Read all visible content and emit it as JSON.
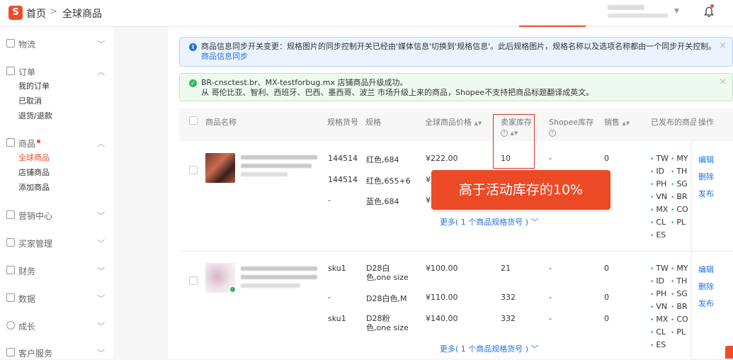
{
  "header": {
    "logo": "S",
    "breadcrumb_home": "首页",
    "breadcrumb_sep": ">",
    "breadcrumb_current": "全球商品"
  },
  "sidebar": {
    "groups": [
      {
        "label": "物流",
        "caret": "﹀"
      },
      {
        "label": "订单",
        "caret": "︿",
        "items": [
          "我的订单",
          "已取消",
          "退货/退款"
        ]
      },
      {
        "label": "商品",
        "caret": "︿",
        "items": [
          "全球商品",
          "店铺商品",
          "添加商品"
        ]
      },
      {
        "label": "营销中心",
        "caret": "﹀"
      },
      {
        "label": "买家管理",
        "caret": "﹀"
      },
      {
        "label": "财务",
        "caret": "﹀"
      },
      {
        "label": "数据",
        "caret": "﹀"
      },
      {
        "label": "成长",
        "caret": "﹀"
      },
      {
        "label": "客户服务",
        "caret": "﹀"
      }
    ]
  },
  "banners": {
    "info_text": "商品信息同步开关变更：规格图片的同步控制开关已经由'媒体信息'切换到'规格信息'。此后规格图片，规格名称以及选项名称都由一个同步开关控制。",
    "info_link": "商品信息同步",
    "ok_line1": "BR-cnsctest.br、MX-testforbug.mx 店铺商品升级成功。",
    "ok_line2": "从 哥伦比亚、智利、西班牙、巴西、墨西哥、波兰 市场升级上来的商品，Shopee不支持把商品标题翻译成英文。",
    "close": "×"
  },
  "table": {
    "headers": {
      "name": "商品名称",
      "sku": "规格货号",
      "variation": "规格",
      "price": "全球商品价格",
      "seller_stock": "卖家库存",
      "shopee_stock": "Shopee库存",
      "sales": "销售",
      "published": "已发布的商品",
      "ops": "操作"
    },
    "sort_icon": "▲▼",
    "help_icon": "?",
    "products": [
      {
        "rows": [
          {
            "sku": "144514",
            "variation": "红色,684",
            "price": "¥222.00",
            "stock": "10",
            "shopee": "-",
            "sales": "0"
          },
          {
            "sku": "144514",
            "variation": "红色,655+6",
            "price": "¥",
            "stock": "",
            "shopee": "",
            "sales": ""
          },
          {
            "sku": "-",
            "variation": "蓝色,684",
            "price": "¥",
            "stock": "",
            "shopee": "",
            "sales": ""
          }
        ],
        "more": "更多( 1 个商品规格货号 ) ﹀",
        "regions": [
          "TW",
          "MY",
          "ID",
          "TH",
          "PH",
          "SG",
          "VN",
          "BR",
          "MX",
          "CO",
          "CL",
          "PL",
          "ES"
        ],
        "ops": [
          "编辑",
          "删除",
          "发布"
        ]
      },
      {
        "rows": [
          {
            "sku": "sku1",
            "variation": "D28白色,one size",
            "price": "¥100.00",
            "stock": "21",
            "shopee": "-",
            "sales": "0"
          },
          {
            "sku": "-",
            "variation": "D28白色,M",
            "price": "¥110.00",
            "stock": "332",
            "shopee": "-",
            "sales": "0"
          },
          {
            "sku": "sku1",
            "variation": "D28粉色,one size",
            "price": "¥140.00",
            "stock": "332",
            "shopee": "-",
            "sales": "0"
          }
        ],
        "more": "更多( 1 个商品规格货号 ) ﹀",
        "regions": [
          "TW",
          "MY",
          "ID",
          "TH",
          "PH",
          "SG",
          "VN",
          "BR",
          "MX",
          "CO",
          "CL",
          "PL",
          "ES"
        ],
        "ops": [
          "编辑",
          "删除",
          "发布"
        ]
      }
    ]
  },
  "callout": "高于活动库存的10%",
  "colors": {
    "brand": "#ee4d2d",
    "link": "#2673dd",
    "success": "#3fb45c"
  }
}
